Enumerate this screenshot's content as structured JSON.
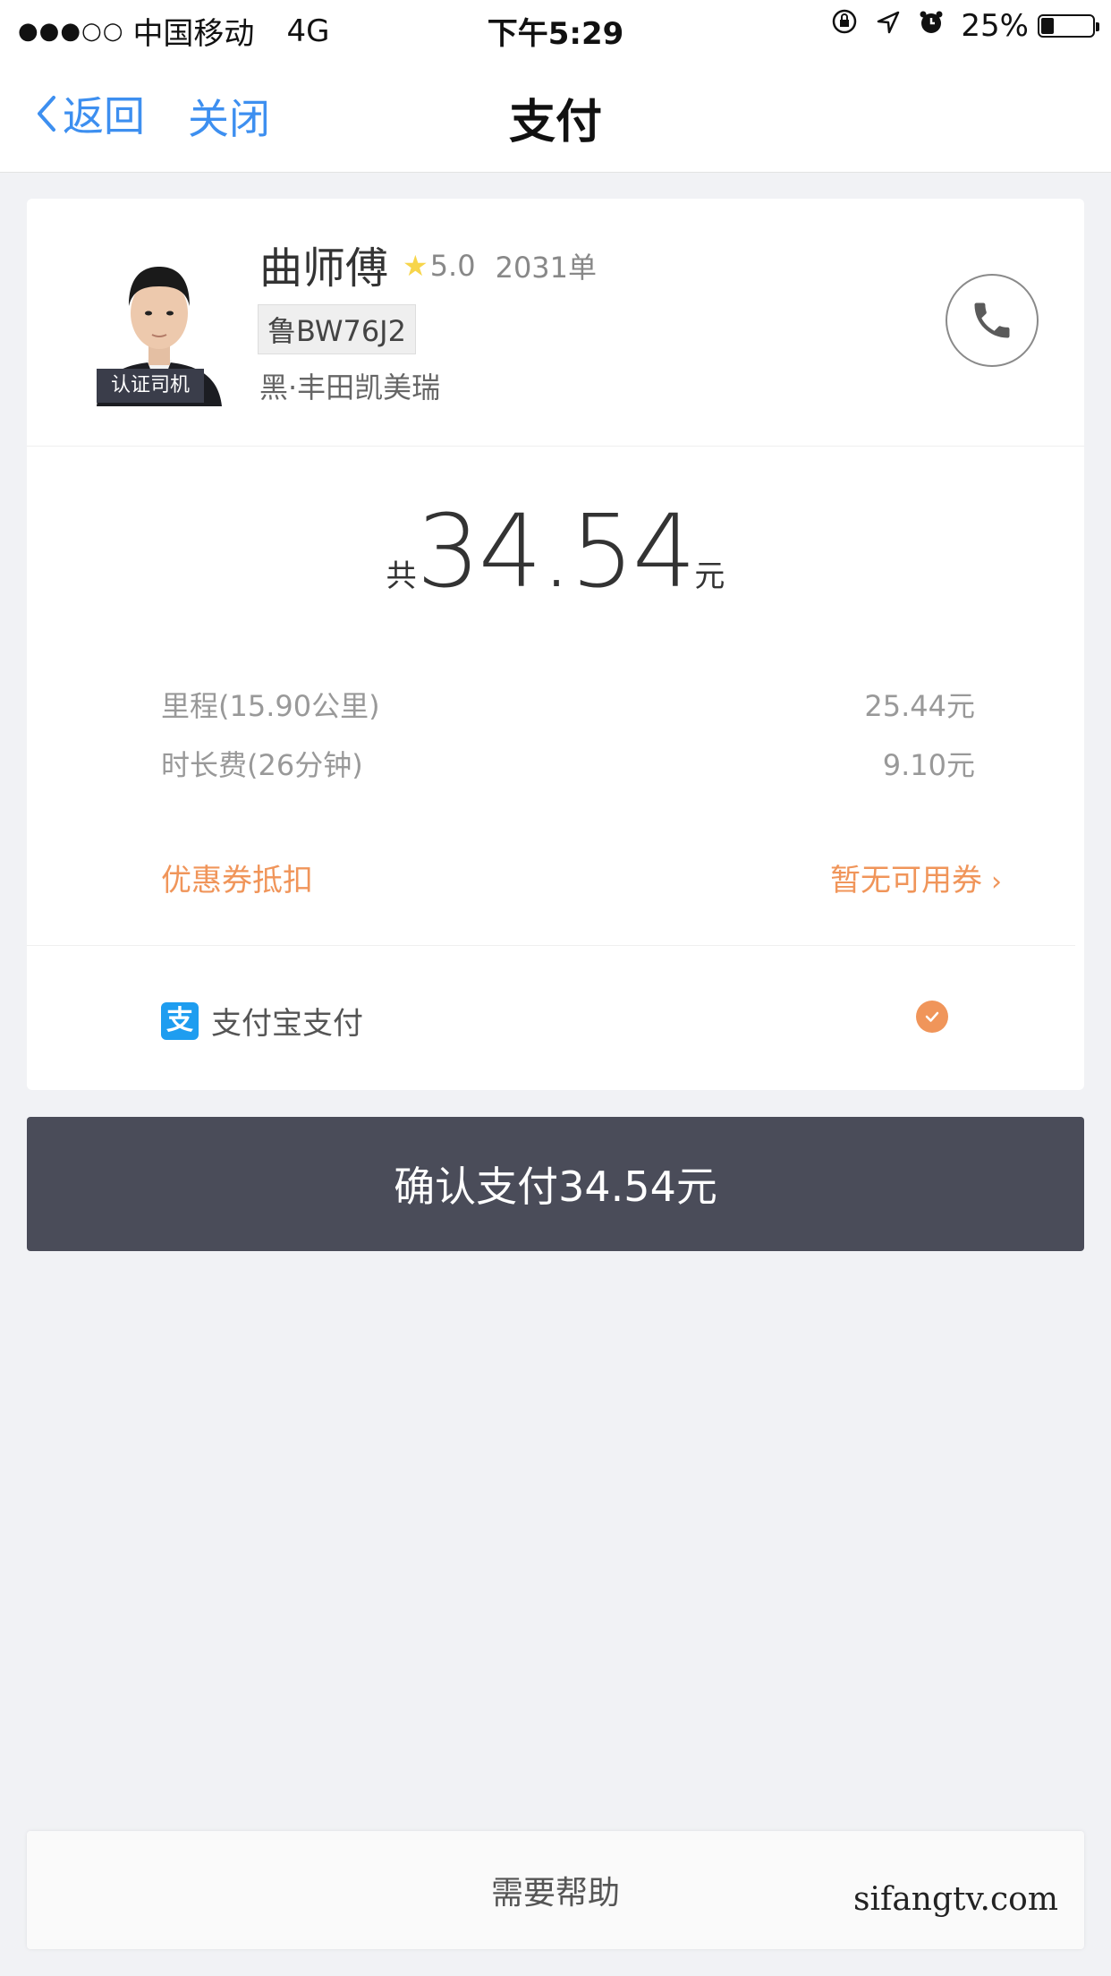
{
  "status_bar": {
    "signal": "●●●○○",
    "carrier": "中国移动",
    "network": "4G",
    "time": "下午5:29",
    "battery_percent": "25%",
    "battery_level": 0.25
  },
  "nav": {
    "back_label": "返回",
    "close_label": "关闭",
    "title": "支付"
  },
  "driver": {
    "certified_label": "认证司机",
    "name": "曲师傅",
    "rating": "5.0",
    "orders": "2031单",
    "plate": "鲁BW76J2",
    "car": "黑·丰田凯美瑞"
  },
  "fare": {
    "prefix": "共",
    "total": "34.54",
    "unit": "元",
    "items": [
      {
        "label": "里程(15.90公里)",
        "value": "25.44元"
      },
      {
        "label": "时长费(26分钟)",
        "value": "9.10元"
      }
    ],
    "coupon_label": "优惠券抵扣",
    "coupon_value": "暂无可用券",
    "coupon_chevron": "›"
  },
  "payment": {
    "icon_glyph": "支",
    "method": "支付宝支付"
  },
  "confirm_label": "确认支付34.54元",
  "help_label": "需要帮助",
  "watermark": "sifangtv.com",
  "colors": {
    "accent_blue": "#3d8ff0",
    "accent_orange": "#f0955a",
    "button_dark": "#4a4c59",
    "alipay_blue": "#1e9df0",
    "star_yellow": "#f7d54b"
  }
}
